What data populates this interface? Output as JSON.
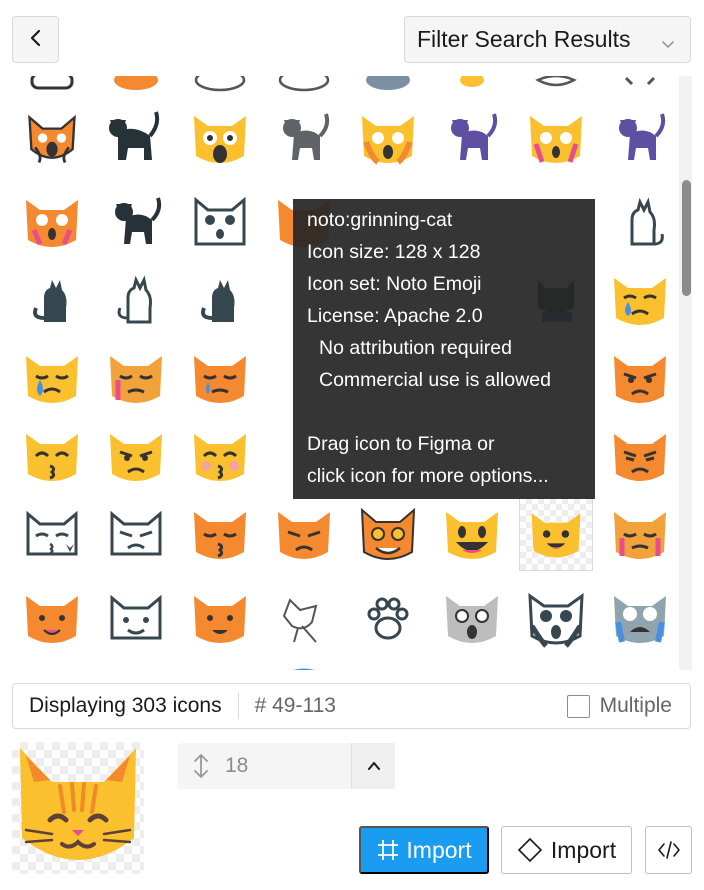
{
  "header": {
    "back_icon": "chevron-left-icon",
    "filter_label": "Filter Search Results",
    "filter_icon": "chevron-down-icon"
  },
  "tooltip": {
    "icon_name": "noto:grinning-cat",
    "icon_size": "Icon size: 128 x 128",
    "icon_set": "Icon set: Noto Emoji",
    "license": "License: Apache 2.0",
    "attribution": "No attribution required",
    "commercial": "Commercial use is allowed",
    "hint_1": "Drag icon to Figma or",
    "hint_2": "click icon for more options..."
  },
  "status": {
    "count": "Displaying 303 icons",
    "range": "# 49-113",
    "multiple_label": "Multiple",
    "multiple_checked": false
  },
  "size": {
    "icon": "resize-vertical-icon",
    "value": "18",
    "step_icon": "chevron-up-icon"
  },
  "actions": {
    "import_figma_label": "Import",
    "import_figma_icon": "hash-frame-icon",
    "import_component_label": "Import",
    "import_component_icon": "diamond-component-icon",
    "code_icon": "code-icon"
  },
  "colors": {
    "accent": "#1a9df0",
    "cat_yellow": "#fbc02d",
    "cat_orange": "#f4892f",
    "cat_dark": "#37474f",
    "cat_purple": "#5e4fa2",
    "cat_gray": "#5f6368",
    "tooltip_bg": "#262626"
  }
}
